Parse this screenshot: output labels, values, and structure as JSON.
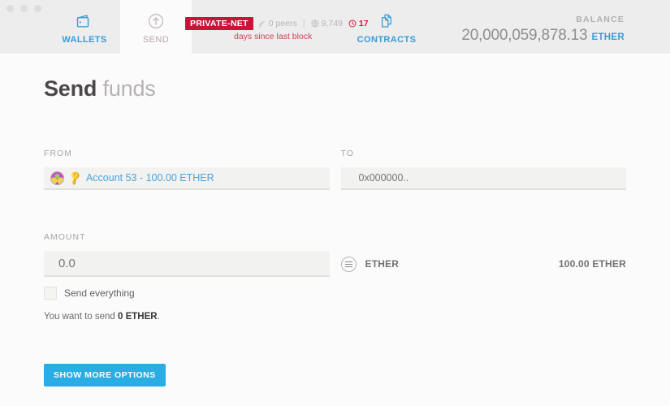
{
  "window": {
    "traffic_lights": [
      "close",
      "minimize",
      "maximize"
    ]
  },
  "header": {
    "tabs": [
      {
        "id": "wallets",
        "label": "WALLETS",
        "icon": "wallet-icon",
        "active": false
      },
      {
        "id": "send",
        "label": "SEND",
        "icon": "upload-arrow-icon",
        "active": true
      },
      {
        "id": "contracts",
        "label": "CONTRACTS",
        "icon": "documents-icon",
        "active": false
      }
    ],
    "network": {
      "badge": "PRIVATE-NET",
      "badge_color": "#c9143a",
      "peers": "0 peers",
      "peers_icon": "signal-icon",
      "separator": "|",
      "block_number": "9,749",
      "block_icon": "block-icon",
      "time_value": "17",
      "time_icon": "clock-icon",
      "time_color": "#cf2040",
      "last_block_text": "days since last block",
      "last_block_color": "#d2405a"
    },
    "balance": {
      "label": "BALANCE",
      "value": "20,000,059,878.13",
      "unit": "ETHER",
      "unit_color": "#3c9ad6"
    }
  },
  "page": {
    "title_bold": "Send",
    "title_light": " funds"
  },
  "form": {
    "from": {
      "label": "FROM",
      "avatar": "identicon-avatar",
      "key_icon": "key-icon",
      "value": "Account 53 - 100.00 ETHER",
      "value_color": "#4aa3e0"
    },
    "to": {
      "label": "TO",
      "value": "",
      "placeholder": "0x000000.."
    },
    "amount": {
      "label": "AMOUNT",
      "value": "",
      "placeholder": "0.0",
      "send_everything_label": "Send everything",
      "send_everything_checked": false,
      "hint_prefix": "You want to send ",
      "hint_amount": "0 ETHER",
      "hint_suffix": "."
    },
    "unit_selector": {
      "icon": "menu-circle-icon",
      "unit": "ETHER",
      "total": "100.00 ETHER"
    },
    "submit": {
      "label": "SHOW MORE OPTIONS",
      "color": "#29ade4"
    }
  }
}
